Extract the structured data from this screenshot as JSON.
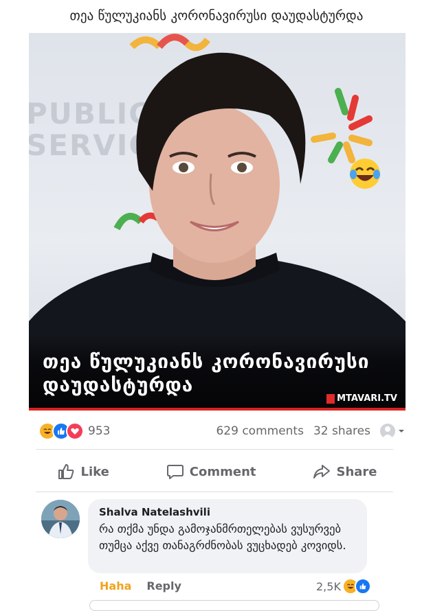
{
  "post": {
    "text": "თეა წულუკიანს კორონავირუსი დაუდასტურდა",
    "image_caption": "თეა წულუკიანს კორონავირუსი დაუდასტურდა",
    "watermark": "MTAVARI.TV",
    "wall_text_left": "PUBLIC SERVICE"
  },
  "stats": {
    "reactions_count": "953",
    "comments": "629 comments",
    "shares": "32 shares",
    "reaction_icons": [
      "haha-icon",
      "like-icon",
      "love-icon"
    ]
  },
  "actions": {
    "like": "Like",
    "comment": "Comment",
    "share": "Share"
  },
  "comment": {
    "author": "Shalva Natelashvili",
    "text": "რა თქმა უნდა გამოჯანმრთელებას ვუსურვებ თუმცა აქვე თანაგრძნობას ვუცხადებ კოვიდს.",
    "haha_label": "Haha",
    "reply_label": "Reply",
    "reaction_count": "2,5K"
  },
  "colors": {
    "accent_blue": "#1877f2",
    "haha_yellow": "#f7b125",
    "love_red": "#f33e58",
    "text_secondary": "#65676b"
  }
}
